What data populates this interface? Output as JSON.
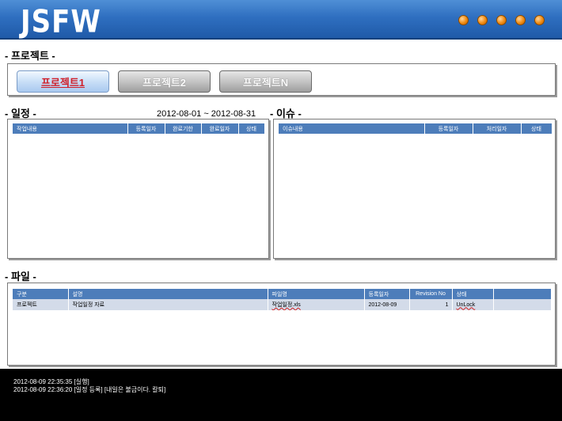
{
  "header": {
    "logo": "JSFW",
    "status_dots": [
      "dot",
      "dot",
      "dot",
      "dot",
      "dot"
    ]
  },
  "project_section": {
    "title": "- 프로젝트 -",
    "tabs": [
      {
        "label": "프로젝트1",
        "active": true
      },
      {
        "label": "프로젝트2",
        "active": false
      },
      {
        "label": "프로젝트N",
        "active": false
      }
    ]
  },
  "schedule": {
    "title": "- 일정 -",
    "date_range": "2012-08-01 ~ 2012-08-31",
    "columns": [
      "작업내용",
      "등록일자",
      "완료기한",
      "완료일자",
      "상태"
    ],
    "rows": []
  },
  "issue": {
    "title": "- 이슈 -",
    "columns": [
      "이슈내용",
      "등록일자",
      "처리일자",
      "상태"
    ],
    "rows": []
  },
  "files": {
    "title": "- 파일 -",
    "columns": [
      "구분",
      "설명",
      "파일명",
      "등록일자",
      "Revision No",
      "상태",
      ""
    ],
    "rows": [
      {
        "category": "프로젝트",
        "description": "작업일정 자료",
        "filename": "작업일정.xls",
        "date": "2012-08-09",
        "revision": "1",
        "status": "UnLock",
        "extra": ""
      }
    ]
  },
  "log": {
    "lines": [
      "2012-08-09 22:35:35  [실행]",
      "2012-08-09 22:36:20  [일정 등록] [내일은 불금이다. 칼퇴]"
    ]
  },
  "colors": {
    "header_blue": "#2f6fc0",
    "table_header": "#4d7dba",
    "table_row": "#d3dbe9",
    "active_tab_text": "#d0202a",
    "status_dot": "#f08a10"
  }
}
